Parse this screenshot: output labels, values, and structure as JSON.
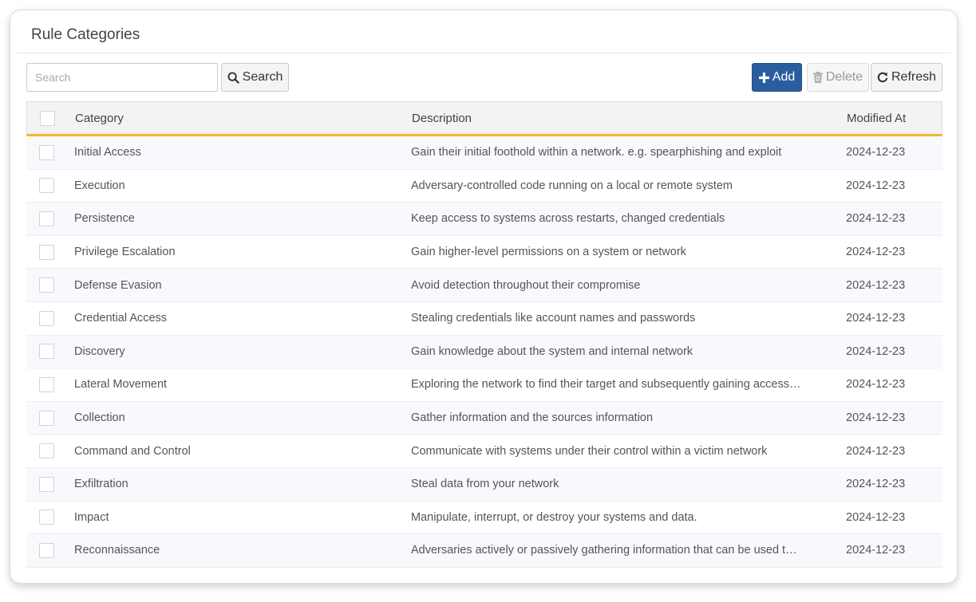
{
  "title": "Rule Categories",
  "search": {
    "placeholder": "Search",
    "button_label": "Search"
  },
  "toolbar": {
    "add_label": "Add",
    "delete_label": "Delete",
    "refresh_label": "Refresh"
  },
  "colors": {
    "primary": "#2a5da0",
    "header_accent": "#f2b632"
  },
  "columns": {
    "category": "Category",
    "description": "Description",
    "modified": "Modified At"
  },
  "rows": [
    {
      "category": "Initial Access",
      "description": "Gain their initial foothold within a network. e.g. spearphishing and exploit",
      "modified": "2024-12-23"
    },
    {
      "category": "Execution",
      "description": "Adversary-controlled code running on a local or remote system",
      "modified": "2024-12-23"
    },
    {
      "category": "Persistence",
      "description": "Keep access to systems across restarts, changed credentials",
      "modified": "2024-12-23"
    },
    {
      "category": "Privilege Escalation",
      "description": "Gain higher-level permissions on a system or network",
      "modified": "2024-12-23"
    },
    {
      "category": "Defense Evasion",
      "description": "Avoid detection throughout their compromise",
      "modified": "2024-12-23"
    },
    {
      "category": "Credential Access",
      "description": "Stealing credentials like account names and passwords",
      "modified": "2024-12-23"
    },
    {
      "category": "Discovery",
      "description": "Gain knowledge about the system and internal network",
      "modified": "2024-12-23"
    },
    {
      "category": "Lateral Movement",
      "description": "Exploring the network to find their target and subsequently gaining access ...",
      "modified": "2024-12-23"
    },
    {
      "category": "Collection",
      "description": "Gather information and the sources information",
      "modified": "2024-12-23"
    },
    {
      "category": "Command and Control",
      "description": "Communicate with systems under their control within a victim network",
      "modified": "2024-12-23"
    },
    {
      "category": "Exfiltration",
      "description": "Steal data from your network",
      "modified": "2024-12-23"
    },
    {
      "category": "Impact",
      "description": "Manipulate, interrupt, or destroy your systems and data.",
      "modified": "2024-12-23"
    },
    {
      "category": "Reconnaissance",
      "description": "Adversaries actively or passively gathering information that can be used to ...",
      "modified": "2024-12-23"
    }
  ]
}
